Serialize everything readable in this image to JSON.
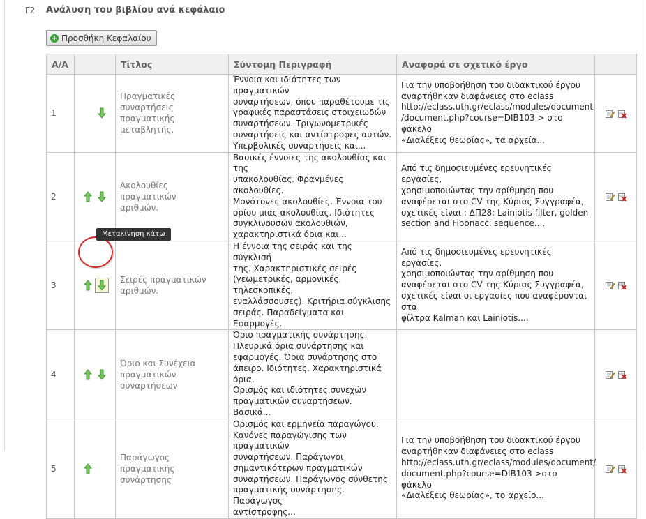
{
  "section": {
    "code": "Γ2",
    "title": "Ανάλυση του βιβλίου ανά κεφάλαιο",
    "add_button_label": "Προσθήκη Κεφαλαίου"
  },
  "table": {
    "headers": [
      "Α/Α",
      "",
      "Τίτλος",
      "Σύντομη Περιγραφή",
      "Αναφορά σε σχετικό έργο",
      ""
    ],
    "rows": [
      {
        "num": "1",
        "title": "Πραγματικές συναρτήσεις\nπραγματικής μεταβλητής.",
        "desc": "Έννοια και ιδιότητες των πραγματικών\nσυναρτήσεων, όπου παραθέτουμε τις\nγραφικές παραστάσεις στοιχειωδών\nσυναρτήσεων. Τριγωνομετρικές\nσυναρτήσεις και αντίστροφες αυτών.\nΥπερβολικές συναρτήσεις και...",
        "ref": "Για την υποβοήθηση του διδακτικού έργου\nαναρτήθηκαν διαφάνειες στο eclass\nhttp://eclass.uth.gr/eclass/modules/document\n/document.php?course=DIB103 > στο φάκελο\n«Διαλέξεις θεωρίας», τα αρχεία...",
        "up": false,
        "down": true
      },
      {
        "num": "2",
        "title": "Ακολουθίες πραγματικών\nαριθμών.",
        "desc": "Βασικές έννοιες της ακολουθίας και της\nυπακολουθίας. Φραγμένες ακολουθίες.\nΜονότονες ακολουθίες. Έννοια του\nορίου μιας ακολουθίας. Ιδιότητες\nσυγκλινουσών ακολουθιών,\nχαρακτηριστικά όρια και...",
        "ref": "Από τις δημοσιευμένες ερευνητικές εργασίες,\nχρησιμοποιώντας την αρίθμηση που\nαναφέρεται στο CV της Κύριας Συγγραφέα,\nσχετικές είναι : ΔΠ28: Lainiotis filter, golden\nsection and Fibonacci sequence....",
        "up": true,
        "down": true
      },
      {
        "num": "3",
        "title": "Σειρές πραγματικών\nαριθμών.",
        "desc": "Η έννοια της σειράς και της σύγκλισή\nτης. Χαρακτηριστικές σειρές\n(γεωμετρικές, αρμονικές, τηλεσκοπικές,\nεναλλάσσουσες). Κριτήρια σύγκλισης\nσειράς. Παραδείγματα και Εφαρμογές.",
        "ref": "Από τις δημοσιευμένες ερευνητικές εργασίες,\nχρησιμοποιώντας την αρίθμηση που\nαναφέρεται στο CV της Κύριας Συγγραφέα,\nσχετικές είναι οι εργασίες που αναφέρονται στα\nφίλτρα Kalman και Lainiotis....",
        "up": true,
        "down": true
      },
      {
        "num": "4",
        "title": "Όριο και Συνέχεια\nπραγματικών\nσυναρτήσεων",
        "desc": "Όριο πραγματικής συνάρτησης.\nΠλευρικά όρια συνάρτησης και\nεφαρμογές. Όρια συνάρτησης στο\nάπειρο. Ιδιότητες. Χαρακτηριστικά όρια.\nΟρισμός και ιδιότητες συνεχών\nπραγματικών συναρτήσεων. Βασικά...",
        "ref": "",
        "up": true,
        "down": true
      },
      {
        "num": "5",
        "title": "Παράγωγος πραγματικής\nσυνάρτησης",
        "desc": "Ορισμός και ερμηνεία παραγώγου.\nΚανόνες παραγώγισης των πραγματικών\nσυναρτήσεων. Παράγωγοι\nσημαντικότερων πραγματικών\nσυναρτήσεων. Παράγωγος σύνθετης\nπραγματικής συνάρτησης. Παράγωγος\nαντίστροφης...",
        "ref": "Για την υποβοήθηση του διδακτικού έργου\nαναρτήθηκαν διαφάνειες στο eclass\nhttp://eclass.uth.gr/eclass/modules/document/\ndocument.php?course=DIB103 >στο φάκελο\n«Διαλέξεις θεωρίας», το αρχείο...",
        "up": true,
        "down": false
      }
    ]
  },
  "tooltip": {
    "text": "Μετακίνηση κάτω",
    "row_index": 2
  },
  "icons": {
    "up": "arrow-up-icon",
    "down": "arrow-down-icon",
    "edit": "edit-icon",
    "delete": "delete-icon",
    "add": "plus-circle-icon"
  },
  "colors": {
    "arrow_green": "#3c9a2e",
    "highlight_ring": "#d22a2a",
    "header_bg": "#f0f0f0"
  }
}
